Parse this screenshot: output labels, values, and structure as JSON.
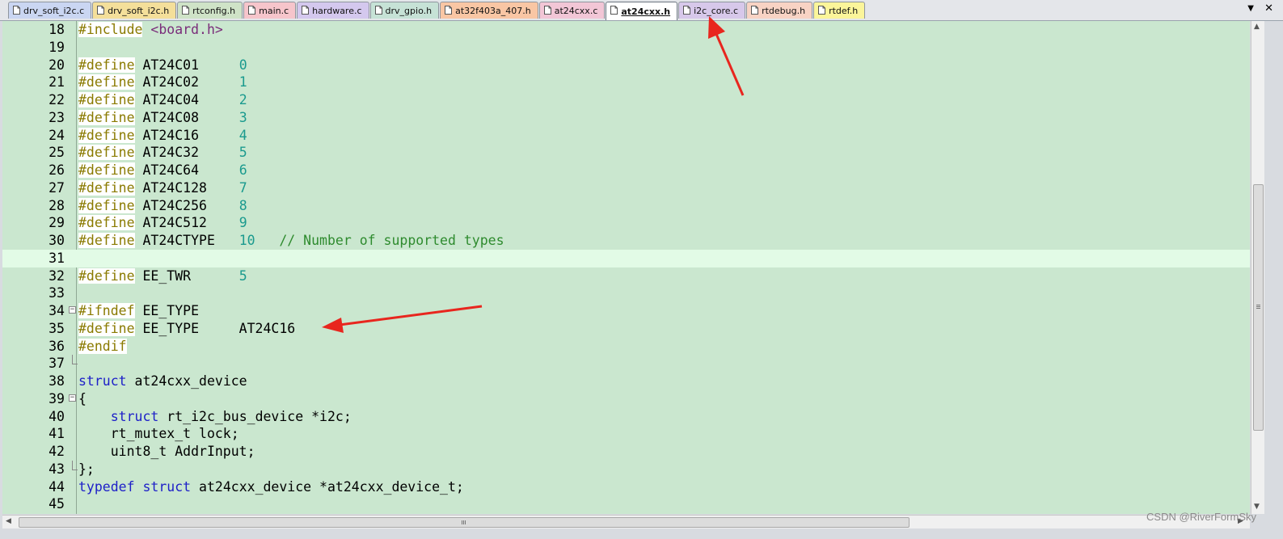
{
  "tabs": [
    {
      "label": "drv_soft_i2c.c",
      "color": "#cad6f2",
      "active": false
    },
    {
      "label": "drv_soft_i2c.h",
      "color": "#f4df9a",
      "active": false
    },
    {
      "label": "rtconfig.h",
      "color": "#cfe3c7",
      "active": false
    },
    {
      "label": "main.c",
      "color": "#f6c5cb",
      "active": false
    },
    {
      "label": "hardware.c",
      "color": "#d4c8ee",
      "active": false
    },
    {
      "label": "drv_gpio.h",
      "color": "#c6e2d6",
      "active": false
    },
    {
      "label": "at32f403a_407.h",
      "color": "#f9c6a4",
      "active": false
    },
    {
      "label": "at24cxx.c",
      "color": "#f2c6d6",
      "active": false
    },
    {
      "label": "at24cxx.h",
      "color": "#ffffff",
      "active": true
    },
    {
      "label": "i2c_core.c",
      "color": "#d7c8ea",
      "active": false
    },
    {
      "label": "rtdebug.h",
      "color": "#f8d3c4",
      "active": false
    },
    {
      "label": "rtdef.h",
      "color": "#fbf59a",
      "active": false
    }
  ],
  "tab_menu_icon": "▼",
  "tab_close_icon": "✕",
  "editor": {
    "current_line": 31,
    "lines": [
      {
        "n": "18",
        "tokens": [
          {
            "t": "#include",
            "c": "pp hl"
          },
          {
            "t": " "
          },
          {
            "t": "<board.h>",
            "c": "str"
          }
        ]
      },
      {
        "n": "19",
        "tokens": []
      },
      {
        "n": "20",
        "tokens": [
          {
            "t": "#define",
            "c": "pp hl"
          },
          {
            "t": " AT24C01     "
          },
          {
            "t": "0",
            "c": "num-lit"
          }
        ]
      },
      {
        "n": "21",
        "tokens": [
          {
            "t": "#define",
            "c": "pp hl"
          },
          {
            "t": " AT24C02     "
          },
          {
            "t": "1",
            "c": "num-lit"
          }
        ]
      },
      {
        "n": "22",
        "tokens": [
          {
            "t": "#define",
            "c": "pp hl"
          },
          {
            "t": " AT24C04     "
          },
          {
            "t": "2",
            "c": "num-lit"
          }
        ]
      },
      {
        "n": "23",
        "tokens": [
          {
            "t": "#define",
            "c": "pp hl"
          },
          {
            "t": " AT24C08     "
          },
          {
            "t": "3",
            "c": "num-lit"
          }
        ]
      },
      {
        "n": "24",
        "tokens": [
          {
            "t": "#define",
            "c": "pp hl"
          },
          {
            "t": " AT24C16     "
          },
          {
            "t": "4",
            "c": "num-lit"
          }
        ]
      },
      {
        "n": "25",
        "tokens": [
          {
            "t": "#define",
            "c": "pp hl"
          },
          {
            "t": " AT24C32     "
          },
          {
            "t": "5",
            "c": "num-lit"
          }
        ]
      },
      {
        "n": "26",
        "tokens": [
          {
            "t": "#define",
            "c": "pp hl"
          },
          {
            "t": " AT24C64     "
          },
          {
            "t": "6",
            "c": "num-lit"
          }
        ]
      },
      {
        "n": "27",
        "tokens": [
          {
            "t": "#define",
            "c": "pp hl"
          },
          {
            "t": " AT24C128    "
          },
          {
            "t": "7",
            "c": "num-lit"
          }
        ]
      },
      {
        "n": "28",
        "tokens": [
          {
            "t": "#define",
            "c": "pp hl"
          },
          {
            "t": " AT24C256    "
          },
          {
            "t": "8",
            "c": "num-lit"
          }
        ]
      },
      {
        "n": "29",
        "tokens": [
          {
            "t": "#define",
            "c": "pp hl"
          },
          {
            "t": " AT24C512    "
          },
          {
            "t": "9",
            "c": "num-lit"
          }
        ]
      },
      {
        "n": "30",
        "tokens": [
          {
            "t": "#define",
            "c": "pp hl"
          },
          {
            "t": " AT24CTYPE   "
          },
          {
            "t": "10",
            "c": "num-lit"
          },
          {
            "t": "   "
          },
          {
            "t": "// Number of supported types",
            "c": "cmt"
          }
        ]
      },
      {
        "n": "31",
        "tokens": []
      },
      {
        "n": "32",
        "tokens": [
          {
            "t": "#define",
            "c": "pp hl"
          },
          {
            "t": " EE_TWR      "
          },
          {
            "t": "5",
            "c": "num-lit"
          }
        ]
      },
      {
        "n": "33",
        "tokens": []
      },
      {
        "n": "34",
        "fold": "open",
        "tokens": [
          {
            "t": "#ifndef",
            "c": "pp hl"
          },
          {
            "t": " EE_TYPE"
          }
        ]
      },
      {
        "n": "35",
        "tokens": [
          {
            "t": "#define",
            "c": "pp hl"
          },
          {
            "t": " EE_TYPE     AT24C16"
          }
        ]
      },
      {
        "n": "36",
        "tokens": [
          {
            "t": "#endif",
            "c": "pp hl"
          }
        ]
      },
      {
        "n": "37",
        "fold": "end",
        "tokens": []
      },
      {
        "n": "38",
        "tokens": [
          {
            "t": "struct",
            "c": "kw"
          },
          {
            "t": " at24cxx_device"
          }
        ]
      },
      {
        "n": "39",
        "fold": "open",
        "tokens": [
          {
            "t": "{"
          }
        ]
      },
      {
        "n": "40",
        "tokens": [
          {
            "t": "    "
          },
          {
            "t": "struct",
            "c": "kw"
          },
          {
            "t": " rt_i2c_bus_device *i2c;"
          }
        ]
      },
      {
        "n": "41",
        "tokens": [
          {
            "t": "    rt_mutex_t lock;"
          }
        ]
      },
      {
        "n": "42",
        "tokens": [
          {
            "t": "    uint8_t AddrInput;"
          }
        ]
      },
      {
        "n": "43",
        "fold": "end",
        "tokens": [
          {
            "t": "};"
          }
        ]
      },
      {
        "n": "44",
        "tokens": [
          {
            "t": "typedef",
            "c": "kw"
          },
          {
            "t": " "
          },
          {
            "t": "struct",
            "c": "kw"
          },
          {
            "t": " at24cxx_device *at24cxx_device_t;"
          }
        ]
      },
      {
        "n": "45",
        "tokens": []
      }
    ]
  },
  "fold_open_icon": "−",
  "scroll_up_icon": "▲",
  "scroll_down_icon": "▼",
  "scroll_left_icon": "◀",
  "scroll_right_icon": "▶",
  "watermark": "CSDN @RiverFormSky",
  "annotation_color": "#e8261e"
}
